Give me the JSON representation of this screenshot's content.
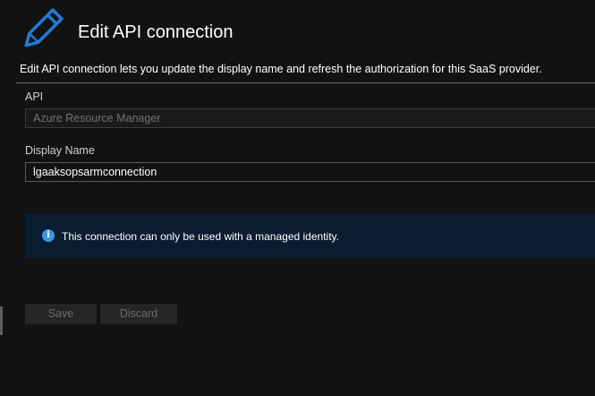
{
  "header": {
    "icon": "pencil-icon",
    "title": "Edit API connection"
  },
  "description": "Edit API connection lets you update the display name and refresh the authorization for this SaaS provider.",
  "fields": {
    "api": {
      "label": "API",
      "value": "Azure Resource Manager",
      "disabled": true
    },
    "display_name": {
      "label": "Display Name",
      "value": "lgaaksopsarmconnection"
    }
  },
  "info": {
    "icon": "info-icon",
    "icon_glyph": "i",
    "text": "This connection can only be used with a managed identity."
  },
  "actions": {
    "save_label": "Save",
    "discard_label": "Discard"
  },
  "colors": {
    "background": "#121212",
    "accent": "#0f6cbd",
    "info_background": "#0a1c30",
    "info_icon": "#3a96dd",
    "divider": "#6a6a6a"
  }
}
